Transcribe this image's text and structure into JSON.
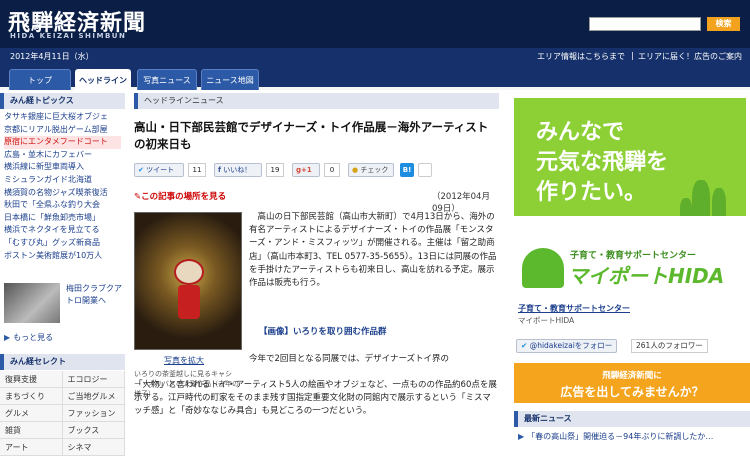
{
  "header": {
    "logo": "飛騨経済新聞",
    "logo_sub": "HIDA KEIZAI SHIMBUN",
    "search_placeholder": "",
    "search_button": "検索"
  },
  "datebar": {
    "date": "2012年4月11日（水）",
    "area_info": "エリア情報はこちらまで",
    "separator": "|",
    "area_ad": "エリアに届く！広告のご案内"
  },
  "tabs": [
    "トップ",
    "ヘッドライン",
    "写真ニュース",
    "ニュース地図"
  ],
  "left": {
    "topics_title": "みん経トピックス",
    "topics": [
      {
        "label": "タサキ銀座に巨大桜オブジェ",
        "hl": false
      },
      {
        "label": "京都にリアル脱出ゲーム部屋",
        "hl": false
      },
      {
        "label": "原宿にエンタメフードコート",
        "hl": true
      },
      {
        "label": "広島・並木にカフェバー",
        "hl": false
      },
      {
        "label": "横浜線に新型車両導入",
        "hl": false
      },
      {
        "label": "ミシュランガイド北海道",
        "hl": false
      },
      {
        "label": "横須賀の名物ジャズ喫茶復活",
        "hl": false
      },
      {
        "label": "秋田で「全県ふな釣り大会",
        "hl": false
      },
      {
        "label": "日本橋に「鮮魚卸売市場」",
        "hl": false
      },
      {
        "label": "横浜でネクタイを見立てる",
        "hl": false
      },
      {
        "label": "「むすび丸」グッズ新商品",
        "hl": false
      },
      {
        "label": "ボストン美術館展が10万人",
        "hl": false
      }
    ],
    "thumb_caption": "梅田クラブクアトロ開業へ",
    "more": "もっと見る",
    "select_title": "みん経セレクト",
    "select_items": [
      "復興支援",
      "エコロジー",
      "まちづくり",
      "ご当地グルメ",
      "グルメ",
      "ファッション",
      "雑貨",
      "ブックス",
      "アート",
      "シネマ"
    ]
  },
  "main": {
    "crumb": "ヘッドラインニュース",
    "headline": "高山・日下部民芸館でデザイナーズ・トイ作品展－海外アーティストの初来日も",
    "share": {
      "tweet": "ツイート",
      "tweet_count": "11",
      "like": "いいね！",
      "like_count": "19",
      "plus": "+1",
      "plus_count": "0",
      "check": "チェック",
      "hatena": "B!"
    },
    "map_link": "この記事の場所を見る",
    "pub_date": "（2012年04月09日）",
    "photo_link": "写真を拡大",
    "photo_caption": "いろりの茶釜越しに見るキャシー・オリバスの人形作品（去年の様子）",
    "body1": "高山の日下部民芸館（高山市大新町）で4月13日から、海外の有名アーティストによるデザイナーズ・トイの作品展「モンスターズ・アンド・ミスフィッツ」が開催される。主催は「留之助商店」（高山市本町3、TEL 0577-35-5655）。13日には同展の作品を手掛けたアーティストらも初来日し、高山を訪れる予定。展示作品は販売も行う。",
    "subhead": "【画像】いろりを取り囲む作品群",
    "body2_first": "今年で2回目となる同展では、デザイナーズトイ界の",
    "body2_rest": "「大物」と言われるトイ・アーティスト5人の絵画やオブジェなど、一点ものの作品約60点を展示する。江戸時代の町家をそのまま残す国指定重要文化財の同館内で展示するという「ミスマッチ感」と「奇妙ななじみ具合」も見どころの一つだという。"
  },
  "right": {
    "banner_line1": "みんなで",
    "banner_line2": "元気な飛騨を",
    "banner_line3": "作りたい。",
    "banner_sub": "子育て・教育サポートセンター",
    "banner_big": "マイポートHIDA",
    "link": "子育て・教育サポートセンター",
    "link_sub": "マイポートHIDA",
    "follow": "@hidakeizaiをフォロー",
    "follow_count": "261人のフォロワー",
    "ad_line1": "飛騨経済新聞に",
    "ad_line2": "広告を出してみませんか？",
    "news_title": "最新ニュース",
    "news_item": "「春の高山祭」開催迫る－94年ぶりに新調したか…"
  },
  "colors": {
    "header_bg": "#0b1f46",
    "tab_active": "#ffffff",
    "accent_orange": "#f2a21c",
    "banner_green": "#8dd036"
  }
}
